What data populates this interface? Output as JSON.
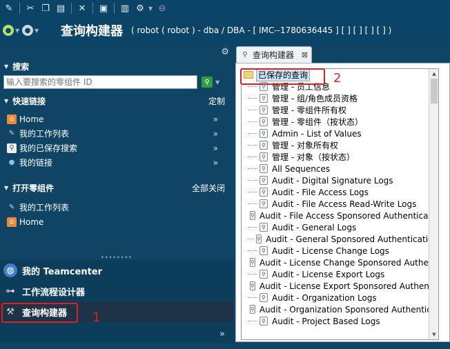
{
  "toolbar": {
    "icons": [
      "edit-icon",
      "cut-icon",
      "copy-icon",
      "paste-icon",
      "delete-icon",
      "save-icon",
      "layout-icon",
      "gear-icon",
      "orbit-icon"
    ]
  },
  "titlebar": {
    "app_title": "查询构建器",
    "context": "( robot ( robot ) - dba / DBA - [ IMC--1780636445 ] [ ] [ ] [ ] [ ] )"
  },
  "leftnav": {
    "search": {
      "header": "搜索",
      "placeholder": "输入要搜索的零组件 ID"
    },
    "quick_links": {
      "header": "快速链接",
      "customize": "定制",
      "items": [
        {
          "label": "Home",
          "icon": "home-icon"
        },
        {
          "label": "我的工作列表",
          "icon": "worklist-icon"
        },
        {
          "label": "我的已保存搜索",
          "icon": "saved-search-icon"
        },
        {
          "label": "我的链接",
          "icon": "link-icon"
        }
      ]
    },
    "open_items": {
      "header": "打开零组件",
      "close_all": "全部关闭",
      "items": [
        {
          "label": "我的工作列表",
          "icon": "worklist-icon"
        },
        {
          "label": "Home",
          "icon": "home-icon"
        }
      ]
    },
    "apps": [
      {
        "label": "我的 Teamcenter",
        "icon": "globe-icon"
      },
      {
        "label": "工作流程设计器",
        "icon": "workflow-icon"
      },
      {
        "label": "查询构建器",
        "icon": "query-builder-icon"
      }
    ]
  },
  "rightpanel": {
    "tab_label": "查询构建器",
    "tree_root": "已保存的查询",
    "tree_items": [
      "管理 - 员工信息",
      "管理 - 组/角色成员资格",
      "管理 - 零组件所有权",
      "管理 - 零组件（按状态）",
      "Admin - List of Values",
      "管理 - 对象所有权",
      "管理 - 对象（按状态）",
      "All Sequences",
      "Audit - Digital Signature Logs",
      "Audit - File Access Logs",
      "Audit - File Access Read-Write Logs",
      "Audit - File Access Sponsored Authentication",
      "Audit - General Logs",
      "Audit - General Sponsored Authentication",
      "Audit - License Change Logs",
      "Audit - License Change Sponsored Authentication",
      "Audit - License Export Logs",
      "Audit - License Export Sponsored Authentication",
      "Audit - Organization Logs",
      "Audit - Organization Sponsored Authentication",
      "Audit - Project Based Logs"
    ]
  },
  "annotations": {
    "marker_1": "1",
    "marker_2": "2"
  },
  "colors": {
    "nav_bg": "#0f4464",
    "highlight": "#e0201c"
  }
}
